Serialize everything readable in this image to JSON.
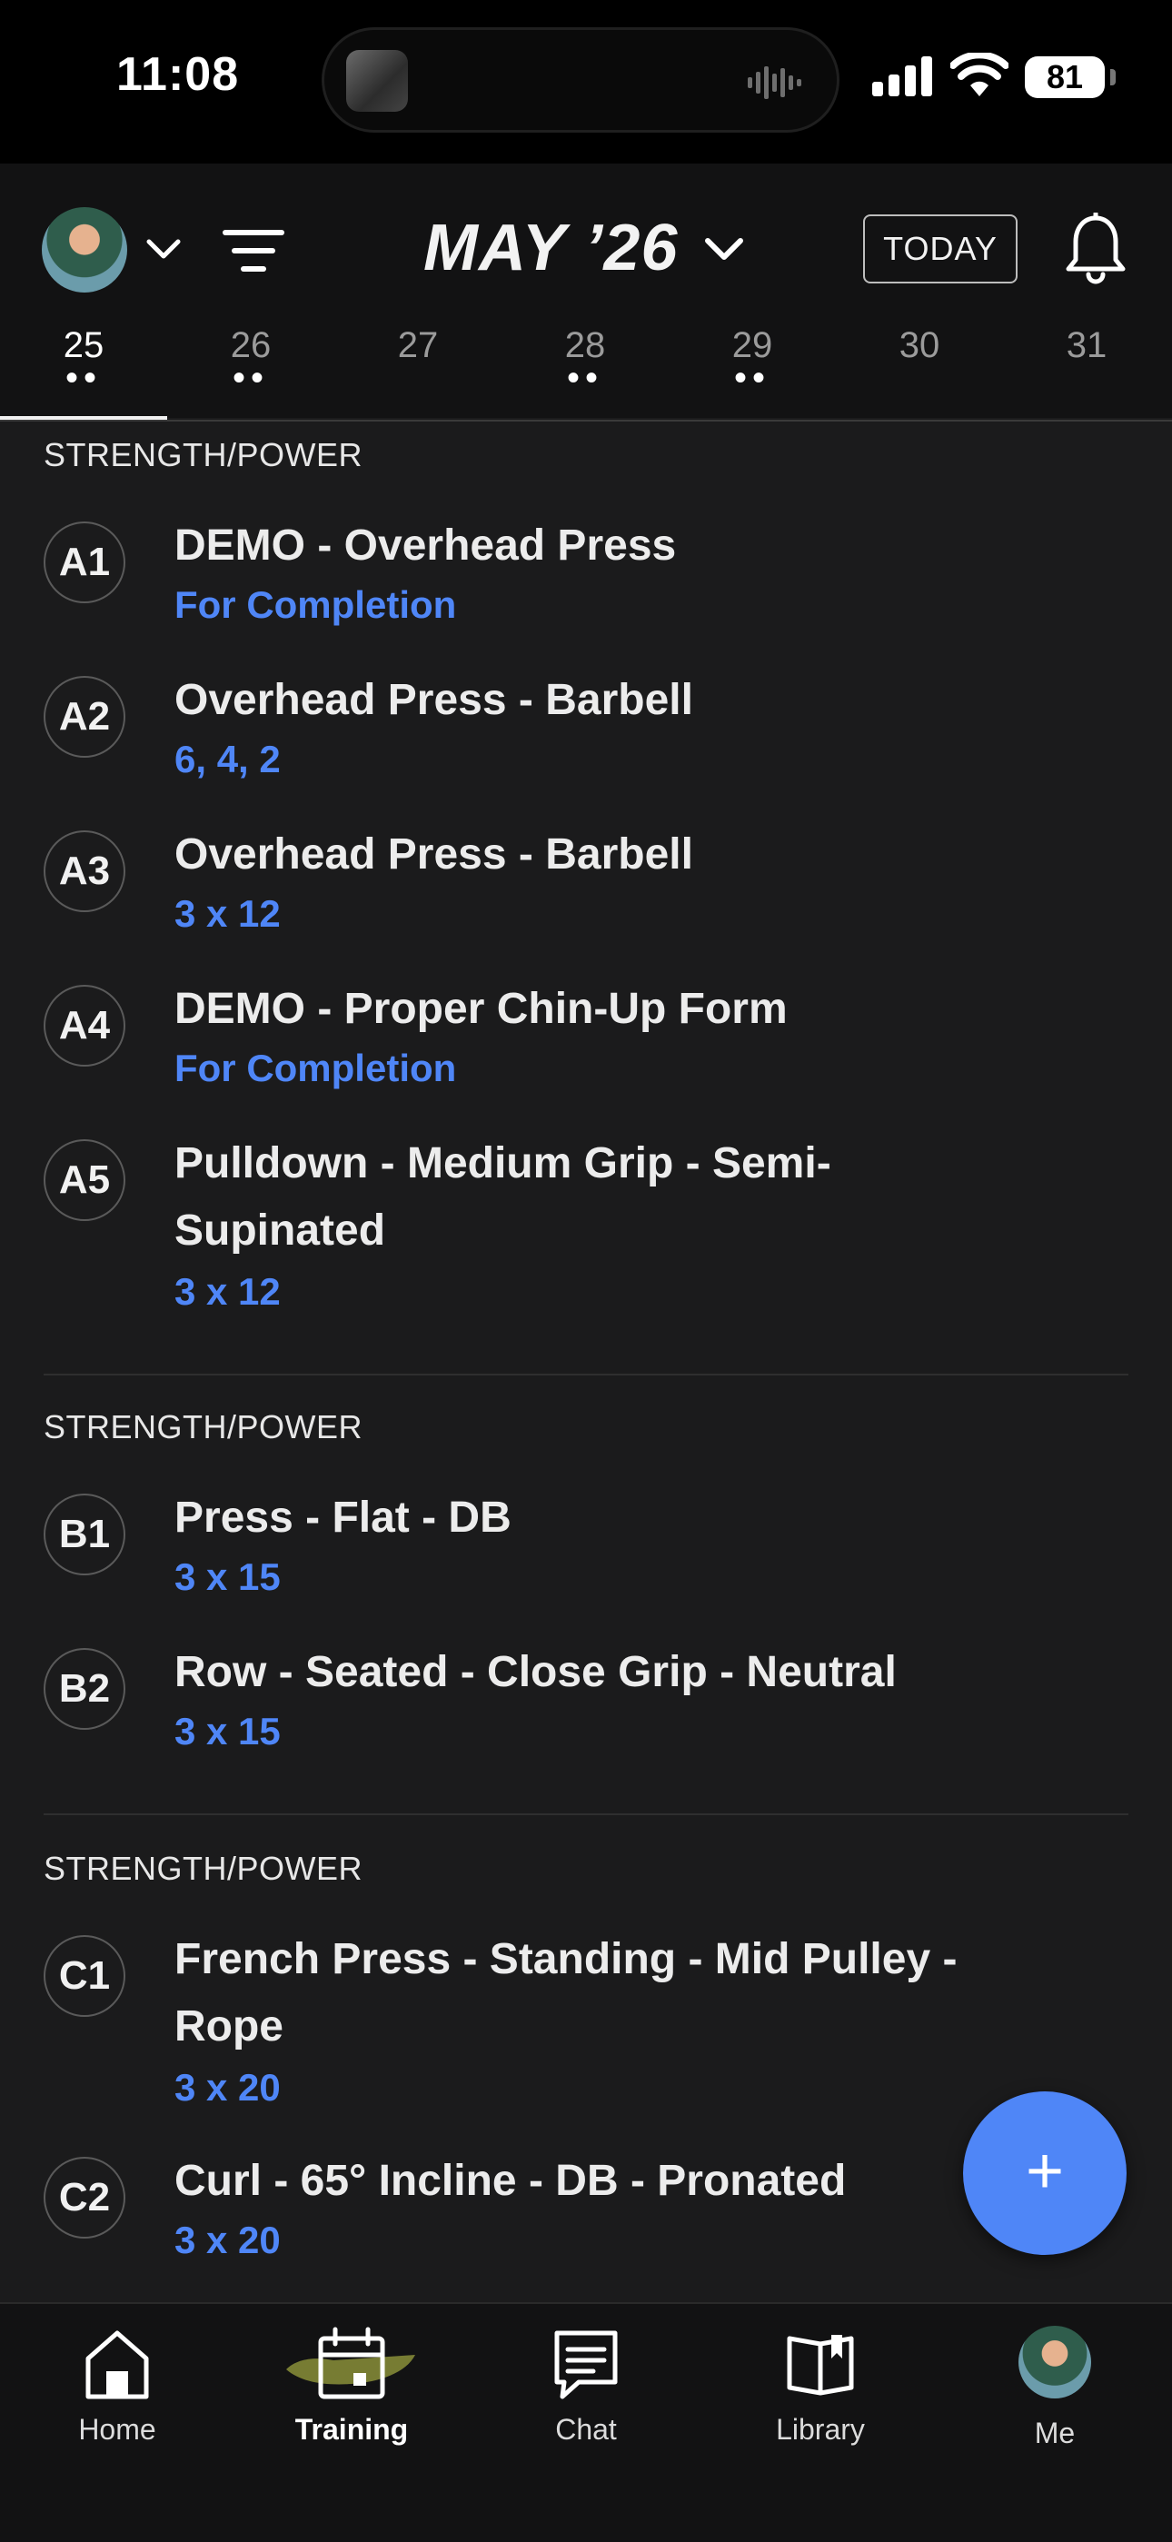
{
  "status_bar": {
    "time": "11:08",
    "battery": "81"
  },
  "header": {
    "month_label": "MAY ’26",
    "today_label": "TODAY",
    "days": [
      {
        "num": "25",
        "dots": "••",
        "selected": true
      },
      {
        "num": "26",
        "dots": "••"
      },
      {
        "num": "27",
        "dots": ""
      },
      {
        "num": "28",
        "dots": "••"
      },
      {
        "num": "29",
        "dots": "••"
      },
      {
        "num": "30",
        "dots": ""
      },
      {
        "num": "31",
        "dots": ""
      }
    ]
  },
  "sections": [
    {
      "title": "STRENGTH/POWER",
      "exercises": [
        {
          "code": "A1",
          "name": "DEMO - Overhead Press",
          "detail": "For Completion"
        },
        {
          "code": "A2",
          "name": "Overhead Press - Barbell",
          "detail": "6, 4, 2"
        },
        {
          "code": "A3",
          "name": "Overhead Press - Barbell",
          "detail": "3 x 12"
        },
        {
          "code": "A4",
          "name": "DEMO - Proper Chin-Up Form",
          "detail": "For Completion"
        },
        {
          "code": "A5",
          "name": "Pulldown - Medium Grip - Semi-Supinated",
          "detail": "3 x 12"
        }
      ]
    },
    {
      "title": "STRENGTH/POWER",
      "exercises": [
        {
          "code": "B1",
          "name": "Press - Flat - DB",
          "detail": "3 x 15"
        },
        {
          "code": "B2",
          "name": "Row - Seated - Close Grip - Neutral",
          "detail": "3 x 15"
        }
      ]
    },
    {
      "title": "STRENGTH/POWER",
      "exercises": [
        {
          "code": "C1",
          "name": "French Press - Standing - Mid Pulley - Rope",
          "detail": "3 x 20"
        },
        {
          "code": "C2",
          "name": "Curl - 65° Incline - DB - Pronated",
          "detail": "3 x 20"
        }
      ]
    }
  ],
  "fab_label": "+",
  "tabs": [
    {
      "label": "Home",
      "icon": "home-icon"
    },
    {
      "label": "Training",
      "icon": "calendar-icon",
      "active": true
    },
    {
      "label": "Chat",
      "icon": "chat-icon"
    },
    {
      "label": "Library",
      "icon": "book-icon"
    },
    {
      "label": "Me",
      "icon": "avatar"
    }
  ],
  "colors": {
    "accent": "#4f86f7",
    "background": "#1b1b1c",
    "header": "#121213"
  }
}
